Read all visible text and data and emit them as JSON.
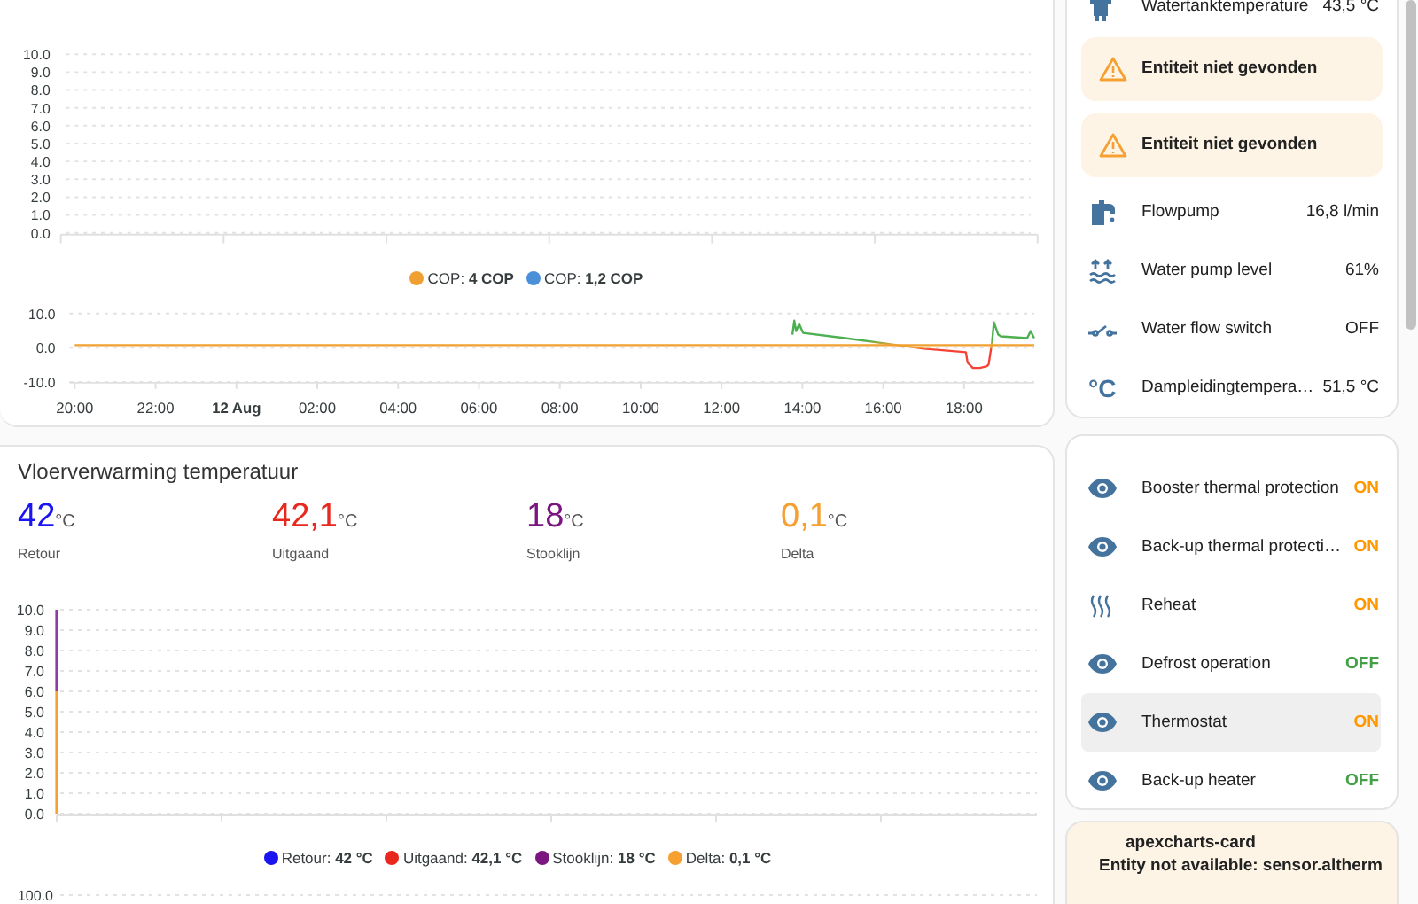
{
  "cop_card": {
    "chart_top": {
      "y_labels": [
        "10.0",
        "9.0",
        "8.0",
        "7.0",
        "6.0",
        "5.0",
        "4.0",
        "3.0",
        "2.0",
        "1.0",
        "0.0"
      ]
    },
    "legend": [
      {
        "label": "COP:",
        "value": "4 COP",
        "color": "#f0a030"
      },
      {
        "label": "COP:",
        "value": "1,2 COP",
        "color": "#4a90d9"
      }
    ],
    "chart_cop": {
      "y_labels": [
        "10.0",
        "0.0",
        "-10.0"
      ],
      "x_labels": [
        {
          "label": "20:00",
          "date": false
        },
        {
          "label": "22:00",
          "date": false
        },
        {
          "label": "12 Aug",
          "date": true
        },
        {
          "label": "02:00",
          "date": false
        },
        {
          "label": "04:00",
          "date": false
        },
        {
          "label": "06:00",
          "date": false
        },
        {
          "label": "08:00",
          "date": false
        },
        {
          "label": "10:00",
          "date": false
        },
        {
          "label": "12:00",
          "date": false
        },
        {
          "label": "14:00",
          "date": false
        },
        {
          "label": "16:00",
          "date": false
        },
        {
          "label": "18:00",
          "date": false
        }
      ]
    }
  },
  "temp_card": {
    "title": "Vloerverwarming temperatuur",
    "stats": [
      {
        "value": "42",
        "unit": "°C",
        "label": "Retour",
        "color": "#1a14f0"
      },
      {
        "value": "42,1",
        "unit": "°C",
        "label": "Uitgaand",
        "color": "#e8281e"
      },
      {
        "value": "18",
        "unit": "°C",
        "label": "Stooklijn",
        "color": "#7b1580"
      },
      {
        "value": "0,1",
        "unit": "°C",
        "label": "Delta",
        "color": "#f5a030"
      }
    ],
    "chart": {
      "y_labels": [
        "10.0",
        "9.0",
        "8.0",
        "7.0",
        "6.0",
        "5.0",
        "4.0",
        "3.0",
        "2.0",
        "1.0",
        "0.0"
      ]
    },
    "legend": [
      {
        "label": "Retour:",
        "value": "42 °C",
        "color": "#1a14f0"
      },
      {
        "label": "Uitgaand:",
        "value": "42,1 °C",
        "color": "#e8281e"
      },
      {
        "label": "Stooklijn:",
        "value": "18 °C",
        "color": "#7b1580"
      },
      {
        "label": "Delta:",
        "value": "0,1 °C",
        "color": "#f5a030"
      }
    ],
    "chart_next": {
      "y_labels": [
        "100.0"
      ]
    }
  },
  "sensor_card": {
    "rows": [
      {
        "kind": "sensor",
        "name": "Watertanktemperature",
        "state": "43,5 °C"
      },
      {
        "kind": "warning",
        "text": "Entiteit niet gevonden"
      },
      {
        "kind": "warning",
        "text": "Entiteit niet gevonden"
      },
      {
        "kind": "sensor",
        "name": "Flowpump",
        "state": "16,8 l/min"
      },
      {
        "kind": "sensor",
        "name": "Water pump level",
        "state": "61%"
      },
      {
        "kind": "sensor",
        "name": "Water flow switch",
        "state": "OFF"
      },
      {
        "kind": "sensor",
        "symbol": "°C",
        "name": "Dampleidingtempera…",
        "state": "51,5 °C"
      }
    ]
  },
  "binary_card": {
    "rows": [
      {
        "name": "Booster thermal protection",
        "state": "ON",
        "on": true,
        "highlighted": false
      },
      {
        "name": "Back-up thermal protecti…",
        "state": "ON",
        "on": true,
        "highlighted": false
      },
      {
        "name": "Reheat",
        "state": "ON",
        "on": true,
        "highlighted": false
      },
      {
        "name": "Defrost operation",
        "state": "OFF",
        "on": false,
        "highlighted": false
      },
      {
        "name": "Thermostat",
        "state": "ON",
        "on": true,
        "highlighted": true
      },
      {
        "name": "Back-up heater",
        "state": "OFF",
        "on": false,
        "highlighted": false
      }
    ]
  },
  "error_card": {
    "title": "apexcharts-card",
    "message": "Entity not available: sensor.altherm"
  }
}
